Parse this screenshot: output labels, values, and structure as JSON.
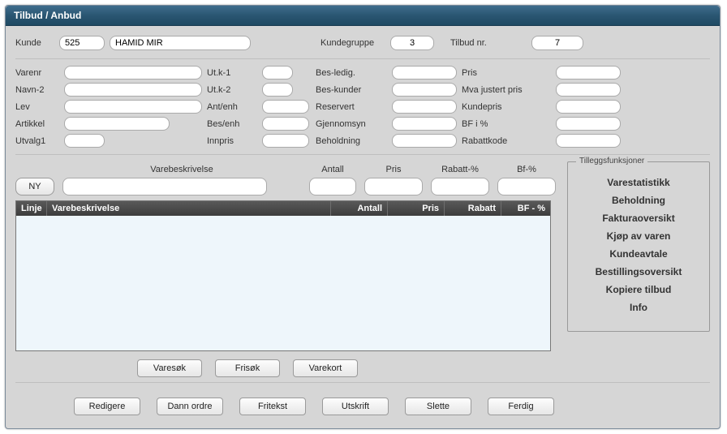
{
  "title": "Tilbud / Anbud",
  "top": {
    "kunde_lbl": "Kunde",
    "kunde_nr": "525",
    "kunde_navn": "HAMID MIR",
    "kundegruppe_lbl": "Kundegruppe",
    "kundegruppe": "3",
    "tilbudnr_lbl": "Tilbud nr.",
    "tilbudnr": "7"
  },
  "fields": {
    "varenr_lbl": "Varenr",
    "navn2_lbl": "Navn-2",
    "lev_lbl": "Lev",
    "artikkel_lbl": "Artikkel",
    "utvalg1_lbl": "Utvalg1",
    "utk1_lbl": "Ut.k-1",
    "utk2_lbl": "Ut.k-2",
    "antenh_lbl": "Ant/enh",
    "besenh_lbl": "Bes/enh",
    "innpris_lbl": "Innpris",
    "besledig_lbl": "Bes-ledig.",
    "beskunder_lbl": "Bes-kunder",
    "reservert_lbl": "Reservert",
    "gjennomsyn_lbl": "Gjennomsyn",
    "beholdning_lbl": "Beholdning",
    "pris_lbl": "Pris",
    "mva_lbl": "Mva justert pris",
    "kundepris_lbl": "Kundepris",
    "bfi_lbl": "BF i %",
    "rabattkode_lbl": "Rabattkode"
  },
  "entry": {
    "ny_btn": "NY",
    "varebeskrivelse_hdr": "Varebeskrivelse",
    "antall_hdr": "Antall",
    "pris_hdr": "Pris",
    "rabatt_hdr": "Rabatt-%",
    "bf_hdr": "Bf-%"
  },
  "grid": {
    "linje": "Linje",
    "varebeskrivelse": "Varebeskrivelse",
    "antall": "Antall",
    "pris": "Pris",
    "rabatt": "Rabatt",
    "bf": "BF - %",
    "rows": []
  },
  "side": {
    "legend": "Tilleggsfunksjoner",
    "links": [
      "Varestatistikk",
      "Beholdning",
      "Fakturaoversikt",
      "Kjøp av varen",
      "Kundeavtale",
      "Bestillingsoversikt",
      "Kopiere tilbud",
      "Info"
    ]
  },
  "mid_buttons": {
    "varesok": "Varesøk",
    "frisok": "Frisøk",
    "varekort": "Varekort"
  },
  "bottom_buttons": {
    "redigere": "Redigere",
    "dannordre": "Dann ordre",
    "fritekst": "Fritekst",
    "utskrift": "Utskrift",
    "slette": "Slette",
    "ferdig": "Ferdig"
  }
}
